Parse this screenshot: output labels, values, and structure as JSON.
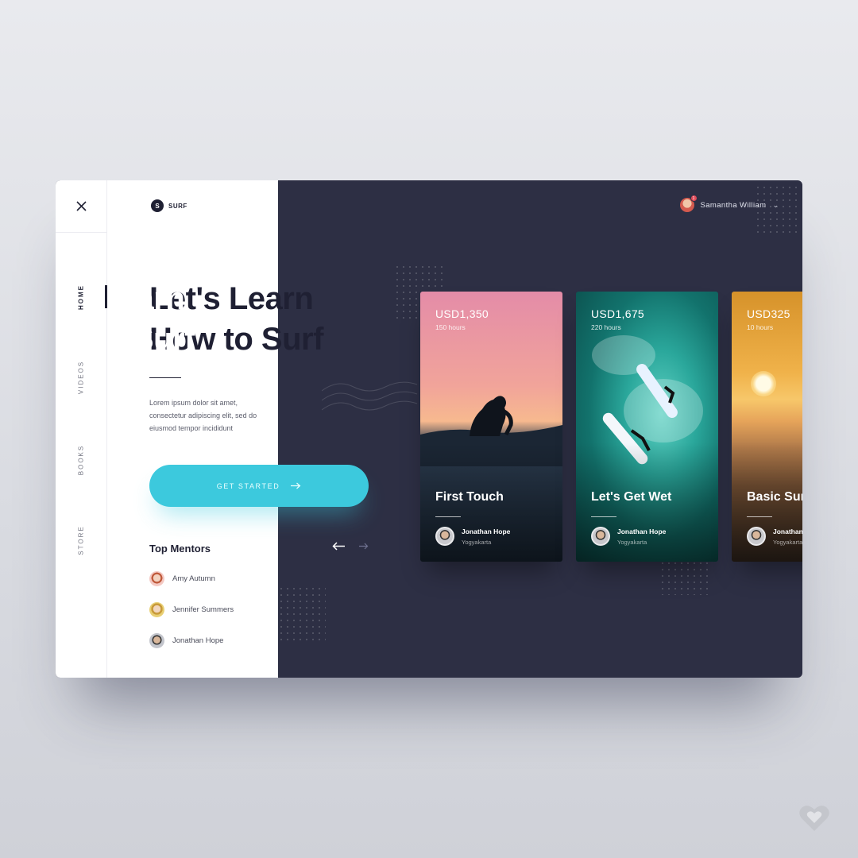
{
  "brand": {
    "mark": "S",
    "name": "SURF"
  },
  "nav": {
    "items": [
      {
        "label": "HOME",
        "active": true
      },
      {
        "label": "VIDEOS",
        "active": false
      },
      {
        "label": "BOOKS",
        "active": false
      },
      {
        "label": "STORE",
        "active": false
      }
    ]
  },
  "hero": {
    "title_line1": "Let's Learn",
    "title_line2": "How to Surf",
    "description": "Lorem ipsum dolor sit amet, consectetur adipiscing elit, sed do eiusmod tempor incididunt",
    "cta_label": "GET STARTED"
  },
  "mentors": {
    "title": "Top Mentors",
    "items": [
      {
        "name": "Amy Autumn"
      },
      {
        "name": "Jennifer Summers"
      },
      {
        "name": "Jonathan Hope"
      }
    ]
  },
  "user": {
    "name": "Samantha William",
    "badge": "1"
  },
  "cards": [
    {
      "price": "USD1,350",
      "hours": "150 hours",
      "title": "First Touch",
      "mentor": "Jonathan Hope",
      "location": "Yogyakarta"
    },
    {
      "price": "USD1,675",
      "hours": "220 hours",
      "title": "Let's Get Wet",
      "mentor": "Jonathan Hope",
      "location": "Yogyakarta"
    },
    {
      "price": "USD325",
      "hours": "10 hours",
      "title": "Basic Surf",
      "mentor": "Jonathan Hope",
      "location": "Yogyakarta"
    }
  ],
  "colors": {
    "accent": "#3cc9dd",
    "dark": "#2d2f44",
    "text": "#1f2033"
  },
  "icons": [
    "close-icon",
    "arrow-right-icon",
    "arrow-left-icon",
    "chevron-down-icon",
    "heart-icon"
  ]
}
